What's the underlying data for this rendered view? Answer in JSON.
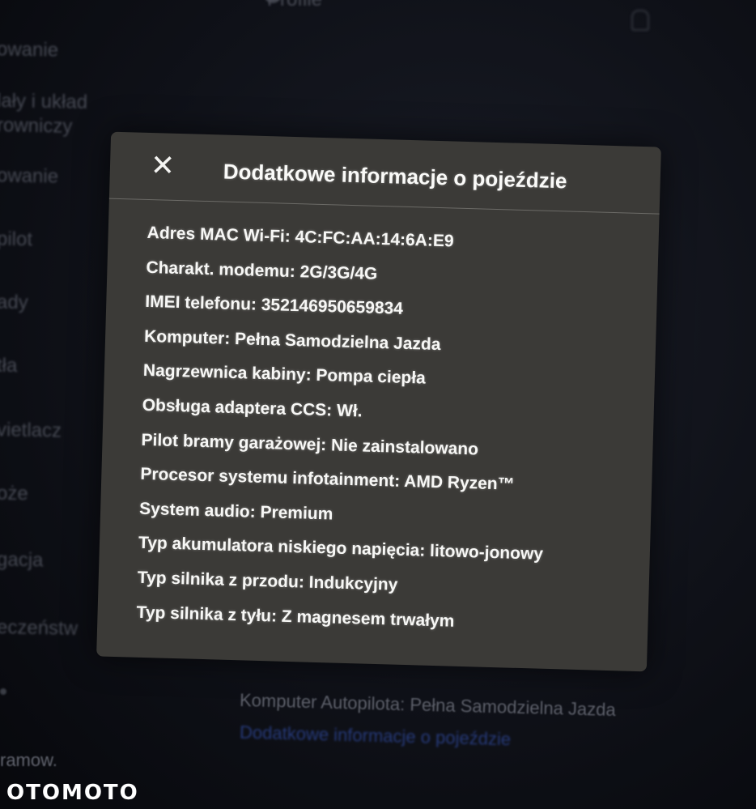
{
  "background": {
    "header_title": "Profile",
    "sidebar_items": [
      "owanie",
      "lały i układ",
      "rowniczy",
      "owanie",
      "pilot",
      "ady",
      "tła",
      "vietlacz",
      "oże",
      "gacja",
      "eczeństw"
    ],
    "footer_text": "Komputer Autopilota: Pełna Samodzielna Jazda",
    "footer_link": "Dodatkowe informacje o pojeździe",
    "bottom_left_text": "ramow."
  },
  "modal": {
    "close_icon": "close-icon",
    "title": "Dodatkowe informacje o pojeździe",
    "items": [
      "Adres MAC Wi-Fi: 4C:FC:AA:14:6A:E9",
      "Charakt. modemu: 2G/3G/4G",
      "IMEI telefonu: 352146950659834",
      "Komputer: Pełna Samodzielna Jazda",
      "Nagrzewnica kabiny: Pompa ciepła",
      "Obsługa adaptera CCS: Wł.",
      "Pilot bramy garażowej: Nie zainstalowano",
      "Procesor systemu infotainment: AMD Ryzen™",
      "System audio: Premium",
      "Typ akumulatora niskiego napięcia: litowo-jonowy",
      "Typ silnika z przodu: Indukcyjny",
      "Typ silnika z tyłu: Z magnesem trwałym"
    ]
  },
  "watermark": "OTOMOTO",
  "colors": {
    "modal_bg": "#3b3a37",
    "text": "#f7f7f5",
    "link": "#263a7a",
    "screen_bg": "#0d0f15"
  }
}
